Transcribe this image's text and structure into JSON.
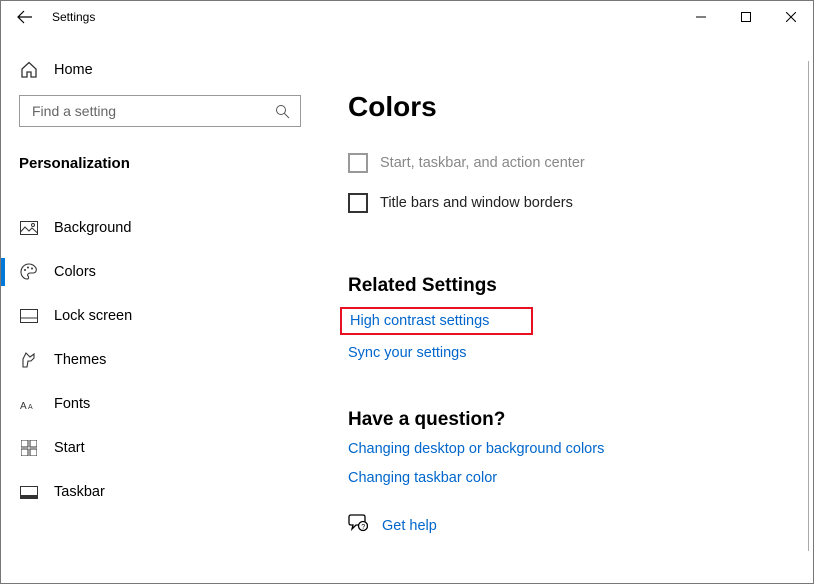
{
  "titlebar": {
    "title": "Settings"
  },
  "sidebar": {
    "home_label": "Home",
    "search_placeholder": "Find a setting",
    "heading": "Personalization",
    "items": [
      {
        "label": "Background"
      },
      {
        "label": "Colors"
      },
      {
        "label": "Lock screen"
      },
      {
        "label": "Themes"
      },
      {
        "label": "Fonts"
      },
      {
        "label": "Start"
      },
      {
        "label": "Taskbar"
      }
    ]
  },
  "main": {
    "heading": "Colors",
    "checkbox1_label": "Start, taskbar, and action center",
    "checkbox2_label": "Title bars and window borders",
    "related_heading": "Related Settings",
    "link_high_contrast": "High contrast settings",
    "link_sync": "Sync your settings",
    "question_heading": "Have a question?",
    "link_changing_desktop": "Changing desktop or background colors",
    "link_changing_taskbar": "Changing taskbar color",
    "link_get_help": "Get help"
  }
}
